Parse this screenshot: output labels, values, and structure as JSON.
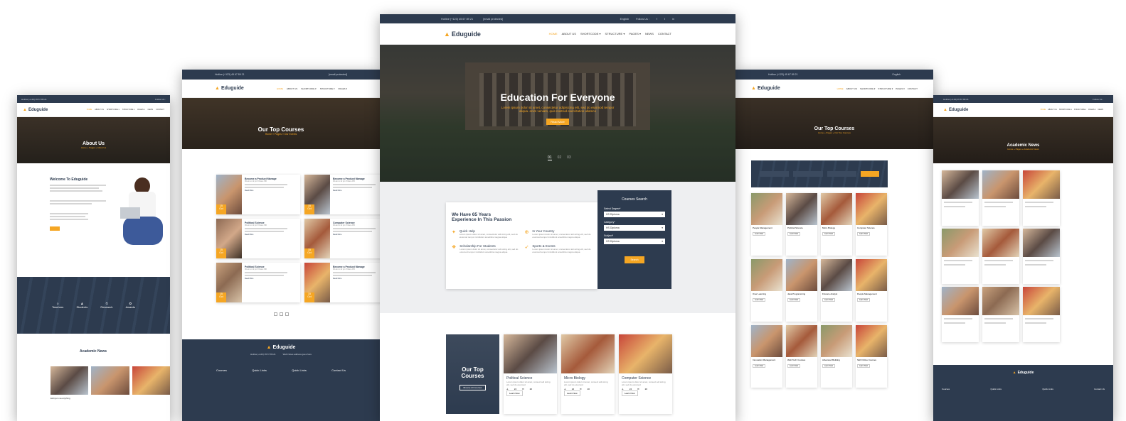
{
  "brand": {
    "name": "Eduguide",
    "accent": "#f5a623",
    "dark": "#2d3b4f"
  },
  "topbar": {
    "hotline": "Hotline (+123) 45 67 89 21",
    "email": "[email protected]",
    "language": "English",
    "follow": "Follow Us :",
    "social_icons": [
      "facebook-icon",
      "twitter-icon",
      "linkedin-icon"
    ]
  },
  "nav": {
    "items": [
      "HOME",
      "ABOUT US",
      "SHORTCODE ▾",
      "STRUCTURE ▾",
      "PAGES ▾",
      "NEWS",
      "CONTACT"
    ]
  },
  "center": {
    "hero_title": "Education For Everyone",
    "hero_text_1": "Lorem ipsum dolor sit amet, consectetur adipisicing elit, sed do eiusmod tempor",
    "hero_text_2": "aliqua. enim veniam, quis nostrud exercitation ullamco",
    "hero_button": "Read More",
    "slides": [
      "01",
      "02",
      "03"
    ],
    "experience_title_1": "We Have 65 Years",
    "experience_title_2": "Experience In This Passion",
    "features": [
      {
        "title": "Quick Help",
        "text": "Lorem ipsum dolor sit amet, consectetur adi sicing elit, sed do eiusmod tempor incididunt ametiittra magna aliqua",
        "icon": "help-icon"
      },
      {
        "title": "In Your Country",
        "text": "Lorem ipsum dolor sit amet, consectetur adi sicing elit, sed do eiusmod tempor incididunt ametiittra magna aliqua",
        "icon": "globe-icon"
      },
      {
        "title": "Scholarship For Students",
        "text": "Lorem ipsum dolor sit amet, consectetur adi sicing elit, sed do eiusmod tempor incididunt ametiittra magna aliqua",
        "icon": "scholarship-icon"
      },
      {
        "title": "Sports & Events",
        "text": "Lorem ipsum dolor sit amet, consectetur adi sicing elit, sed do eiusmod tempor incididunt ametiittra magna aliqua",
        "icon": "sports-icon"
      }
    ],
    "search": {
      "title": "Courses Search",
      "degree_label": "Select Degree*",
      "degree_value": "HS Diploma",
      "category_label": "Category*",
      "category_value": "HS Diploma",
      "subject_label": "Subject*",
      "subject_value": "HS Diploma",
      "button": "Search"
    },
    "our_top_1": "Our Top",
    "our_top_2": "Courses",
    "browse_all": "Browse All Courses",
    "courses": [
      {
        "title": "Political Science",
        "text": "Lorem ipsum dolor sit amet, consect adi sicing elit, sed do eiusmod",
        "students": "24",
        "comments": "20",
        "button": "Learn Now"
      },
      {
        "title": "Micro Biology",
        "text": "Lorem ipsum dolor sit amet, consect adi sicing elit, sed do eiusmod",
        "students": "24",
        "comments": "20",
        "button": "Learn Now"
      },
      {
        "title": "Computer Science",
        "text": "Lorem ipsum dolor sit amet, consect adi sicing elit, sed do eiusmod",
        "students": "24",
        "comments": "20",
        "button": "Learn Now"
      }
    ]
  },
  "left1": {
    "hero_title": "About Us",
    "breadcrumb": "Home » Pages » About Us",
    "welcome_title": "Welcome To Eduguide",
    "stats": [
      "Teachers",
      "Students",
      "Research",
      "Awards"
    ],
    "news_title": "Academic News",
    "news_caption": "Eshiyum sa anything"
  },
  "left2": {
    "hero_title": "Our Top Courses",
    "breadcrumb": "Home » Pages » Our Events",
    "events": [
      {
        "day": "15",
        "month": "Oct",
        "title": "Become a Product Manage",
        "time": "09 am to 12 pm",
        "place": "Tribune PIK",
        "read": "Read More"
      },
      {
        "day": "15",
        "month": "Oct",
        "title": "Become a Product Manage",
        "time": "09 am to 12 pm",
        "place": "Tribune PIK",
        "read": "Read More"
      },
      {
        "day": "15",
        "month": "Oct",
        "title": "Political Science",
        "time": "09 am to 12 pm",
        "place": "Tribune PIK",
        "read": "Read More"
      },
      {
        "day": "15",
        "month": "Oct",
        "title": "Computer Science",
        "time": "09 am to 12 pm",
        "place": "Tribune PIK",
        "read": "Read More"
      },
      {
        "day": "15",
        "month": "Oct",
        "title": "Political Science",
        "time": "09 am to 12 pm",
        "place": "Tribune PIK",
        "read": "Read More"
      },
      {
        "day": "15",
        "month": "Oct",
        "title": "Become a Product Manage",
        "time": "09 am to 12 pm",
        "place": "Tribune PIK",
        "read": "Read More"
      }
    ],
    "footer_cols": [
      "Courses",
      "Quick Links",
      "Quick Links",
      "Contact Us"
    ],
    "footer_hotline": "Hotline (+123) 45 67 89 21",
    "footer_address": "Web Notes address goes here"
  },
  "right1": {
    "hero_title": "Our Top Courses",
    "breadcrumb": "Home » Pages » Our Top Courses",
    "courses": [
      "People Management",
      "Political Science",
      "Micro Biology",
      "Computer Science",
      "Over Learning",
      "Java Programming",
      "Finance Analyst",
      "People Management",
      "Innovation Management",
      "Web Tech Courses",
      "Advanced Building",
      "Skill Online Courses"
    ],
    "learn": "Learn Now"
  },
  "right2": {
    "hero_title": "Academic News",
    "breadcrumb": "Home » Pages » Academic News"
  }
}
